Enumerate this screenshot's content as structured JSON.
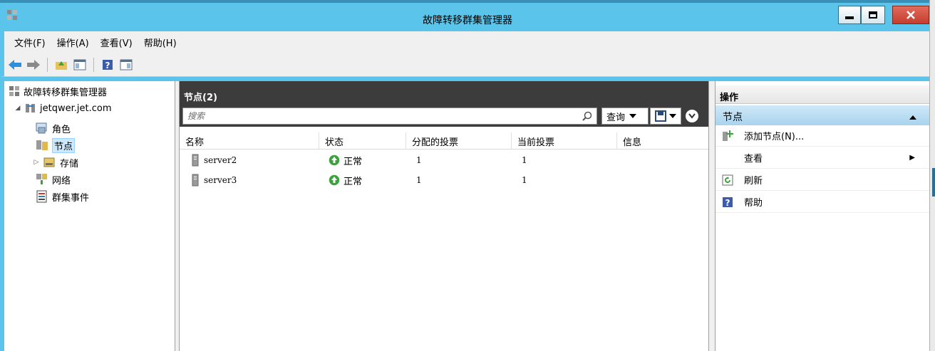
{
  "window": {
    "title": "故障转移群集管理器"
  },
  "menu": {
    "items": [
      "文件(F)",
      "操作(A)",
      "查看(V)",
      "帮助(H)"
    ]
  },
  "tree": {
    "root": "故障转移群集管理器",
    "cluster": "jetqwer.jet.com",
    "children": [
      "角色",
      "节点",
      "存储",
      "网络",
      "群集事件"
    ],
    "selected": "节点"
  },
  "center": {
    "header": "节点(2)",
    "search_placeholder": "搜索",
    "query_label": "查询",
    "columns": [
      "名称",
      "状态",
      "分配的投票",
      "当前投票",
      "信息"
    ],
    "rows": [
      {
        "name": "server2",
        "status": "正常",
        "assigned_vote": "1",
        "current_vote": "1",
        "info": ""
      },
      {
        "name": "server3",
        "status": "正常",
        "assigned_vote": "1",
        "current_vote": "1",
        "info": ""
      }
    ]
  },
  "actions": {
    "title": "操作",
    "section": "节点",
    "items": [
      {
        "label": "添加节点(N)...",
        "icon": "add-node-icon"
      },
      {
        "label": "查看",
        "icon": "",
        "submenu": true
      },
      {
        "label": "刷新",
        "icon": "refresh-icon"
      },
      {
        "label": "帮助",
        "icon": "help-icon"
      }
    ]
  },
  "colors": {
    "titlebar": "#5bc4ea",
    "header_dark": "#3c3c3c",
    "status_ok": "#3aa33a",
    "close_button": "#c43e2d"
  }
}
